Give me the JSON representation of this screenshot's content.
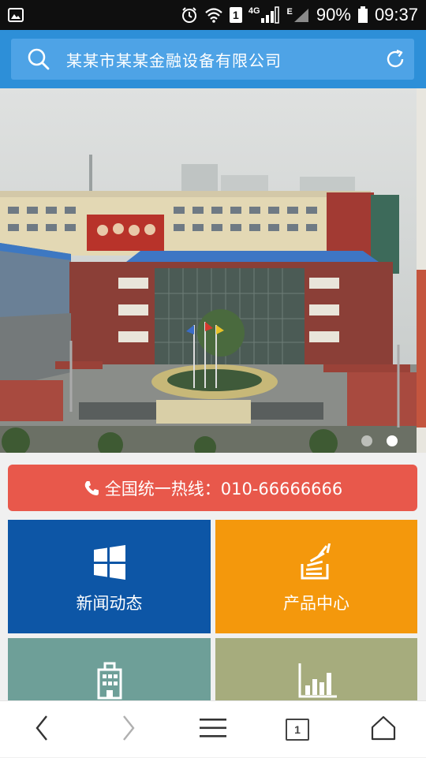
{
  "status_bar": {
    "network_label": "4G",
    "network2_label": "E",
    "sim_label": "1",
    "battery_percent": "90%",
    "time": "09:37"
  },
  "search": {
    "text": "某某市某某金融设备有限公司"
  },
  "banner": {
    "slide_count": 2,
    "active_slide": 2
  },
  "hotline": {
    "label": "全国统一热线：010-66666666"
  },
  "tiles": [
    {
      "label": "新闻动态",
      "icon": "windows-icon",
      "color": "#0d56a6"
    },
    {
      "label": "产品中心",
      "icon": "stack-icon",
      "color": "#f4980c"
    },
    {
      "label": "",
      "icon": "building-icon",
      "color": "#6e9f98"
    },
    {
      "label": "",
      "icon": "bar-chart-icon",
      "color": "#a6ac7d"
    }
  ],
  "bottom_nav": {
    "tab_count": "1"
  }
}
